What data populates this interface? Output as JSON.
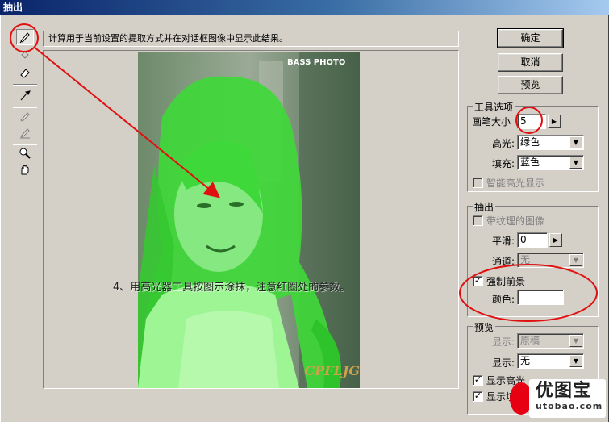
{
  "window": {
    "title": "抽出"
  },
  "status_message": "计算用于当前设置的提取方式并在对话框图像中显示此结果。",
  "buttons": {
    "ok": "确定",
    "cancel": "取消",
    "preview": "预览"
  },
  "tool_options": {
    "title": "工具选项",
    "brush_size_label": "画笔大小",
    "brush_size_value": "5",
    "highlight_label": "高光:",
    "highlight_value": "绿色",
    "fill_label": "填充:",
    "fill_value": "蓝色",
    "smart_highlight_label": "智能高光显示"
  },
  "extraction": {
    "title": "抽出",
    "textured_image_label": "带纹理的图像",
    "smooth_label": "平滑:",
    "smooth_value": "0",
    "channel_label": "通道:",
    "channel_value": "无",
    "force_foreground_label": "强制前景",
    "force_foreground_checked": "✓",
    "color_label": "颜色:"
  },
  "preview_section": {
    "title": "预览",
    "show_label": "显示:",
    "show_value": "原稿",
    "display_label": "显示:",
    "display_value": "无",
    "show_highlight_label": "显示高光",
    "show_fill_label": "显示填充",
    "show_highlight_checked": "✓",
    "show_fill_checked": "✓"
  },
  "photo": {
    "top_watermark": "BASS PHOTO",
    "bottom_watermark": "CPFLJG"
  },
  "annotation_caption": "4、用高光器工具按图示涂抹，注意红圈处的参数。",
  "site_watermark": {
    "brand": "优图宝",
    "url": "utobao.com"
  },
  "colors": {
    "highlight": "#3fe03f",
    "annotation": "#e01010",
    "title_bar": "#0a246a"
  },
  "icons": [
    "edge-highlighter-icon",
    "fill-bucket-icon",
    "eraser-icon",
    "eyedropper-icon",
    "cleanup-icon",
    "edge-touchup-icon",
    "zoom-icon",
    "hand-icon"
  ]
}
